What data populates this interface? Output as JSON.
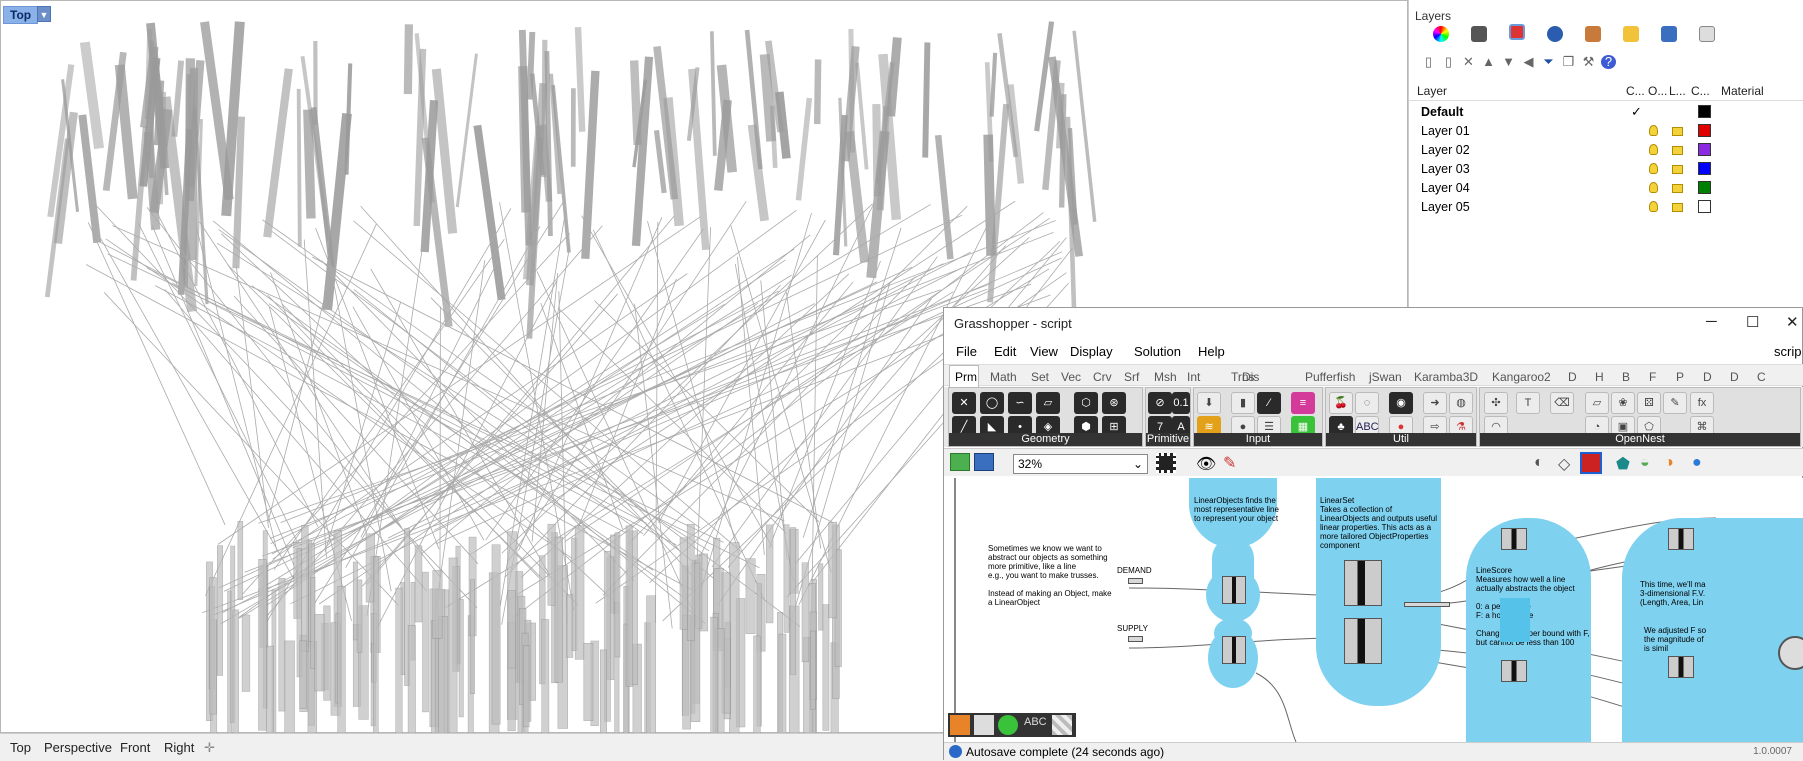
{
  "viewport": {
    "active": "Top"
  },
  "viewport_tabs": [
    "Top",
    "Perspective",
    "Front",
    "Right"
  ],
  "layers": {
    "title": "Layers",
    "headers": {
      "name": "Layer",
      "current": "C...",
      "on": "O...",
      "lock": "L...",
      "color": "C...",
      "material": "Material"
    },
    "rows": [
      {
        "name": "Default",
        "current": "✓",
        "color": "#000000"
      },
      {
        "name": "Layer 01",
        "color": "#e00000"
      },
      {
        "name": "Layer 02",
        "color": "#8a2be2"
      },
      {
        "name": "Layer 03",
        "color": "#0000ff"
      },
      {
        "name": "Layer 04",
        "color": "#008000"
      },
      {
        "name": "Layer 05",
        "color": "#ffffff"
      }
    ]
  },
  "gh": {
    "title": "Grasshopper - script",
    "menu": [
      "File",
      "Edit",
      "View",
      "Display",
      "Solution",
      "Help"
    ],
    "menu_right": "scrip",
    "tabs": [
      "Prm",
      "Math",
      "Set",
      "Vec",
      "Crv",
      "Srf",
      "Msh",
      "Int",
      "Trns",
      "Dis",
      "Pufferfish",
      "jSwan",
      "Karamba3D",
      "Kangaroo2",
      "D",
      "H",
      "B",
      "F",
      "P",
      "D",
      "D",
      "C"
    ],
    "groups": [
      "Geometry",
      "Primitive",
      "Input",
      "Util",
      "OpenNest"
    ],
    "zoom": "32%",
    "notes": {
      "linearobjects": "LinearObjects finds the most representative line to represent your object",
      "linearset": "LinearSet\nTakes a collection of LinearObjects and outputs useful linear properties. This acts as a more tailored ObjectProperties component",
      "intro": "Sometimes we know we want to abstract our objects as something more primitive, like a line\n e.g., you want to make trusses.\n\nInstead of making an Object, make a LinearObject",
      "linescore": "LineScore\nMeasures how well a line actually abstracts the object\n\n0: a perfect line\nF: a horrible line\n\nChange the upper bound with F, but cannot be less than 100",
      "right1": "This time, we'll ma\n3-dimensional F.V.\n(Length, Area, Lin",
      "right2": "We adjusted F so\nthe magnitude of\nis simil"
    },
    "labels": {
      "demand": "DEMAND",
      "supply": "SUPPLY"
    },
    "status": "Autosave complete (24 seconds ago)",
    "version": "1.0.0007"
  },
  "icons": [
    "rhino-circle-icon",
    "camera-icon",
    "layers-icon",
    "sphere-icon",
    "pen-icon",
    "folder-icon",
    "display-icon",
    "document-icon"
  ]
}
